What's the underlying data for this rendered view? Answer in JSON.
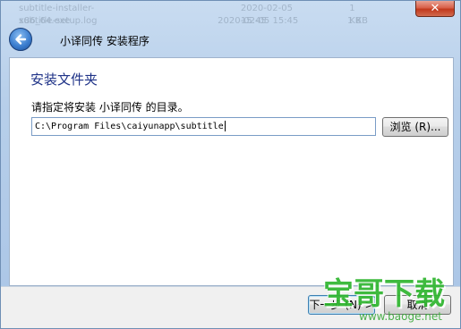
{
  "background": {
    "rows": [
      [
        "subtitle-installer-x86_64.exe",
        "2020-02-05 15:45",
        "1 KB"
      ],
      [
        "subtitle-setup.log",
        "2020-02-05 15:45",
        "1 KB"
      ]
    ]
  },
  "window": {
    "title": "小译同传 安装程序",
    "close_glyph": "✕"
  },
  "page": {
    "heading": "安装文件夹",
    "instruction": "请指定将安装 小译同传 的目录。",
    "path_value": "C:\\Program Files\\caiyunapp\\subtitle",
    "browse_label": "浏览 (R)..."
  },
  "footer": {
    "next_label": "下一步 (N) >",
    "cancel_label": "取消"
  },
  "watermark": {
    "brand": "宝哥下载",
    "url": "www.baoge.net"
  },
  "colors": {
    "heading": "#1e3287",
    "watermark": "#2fb62f",
    "close_button": "#c1391c"
  },
  "icons": [
    "back-arrow-icon",
    "close-icon"
  ]
}
